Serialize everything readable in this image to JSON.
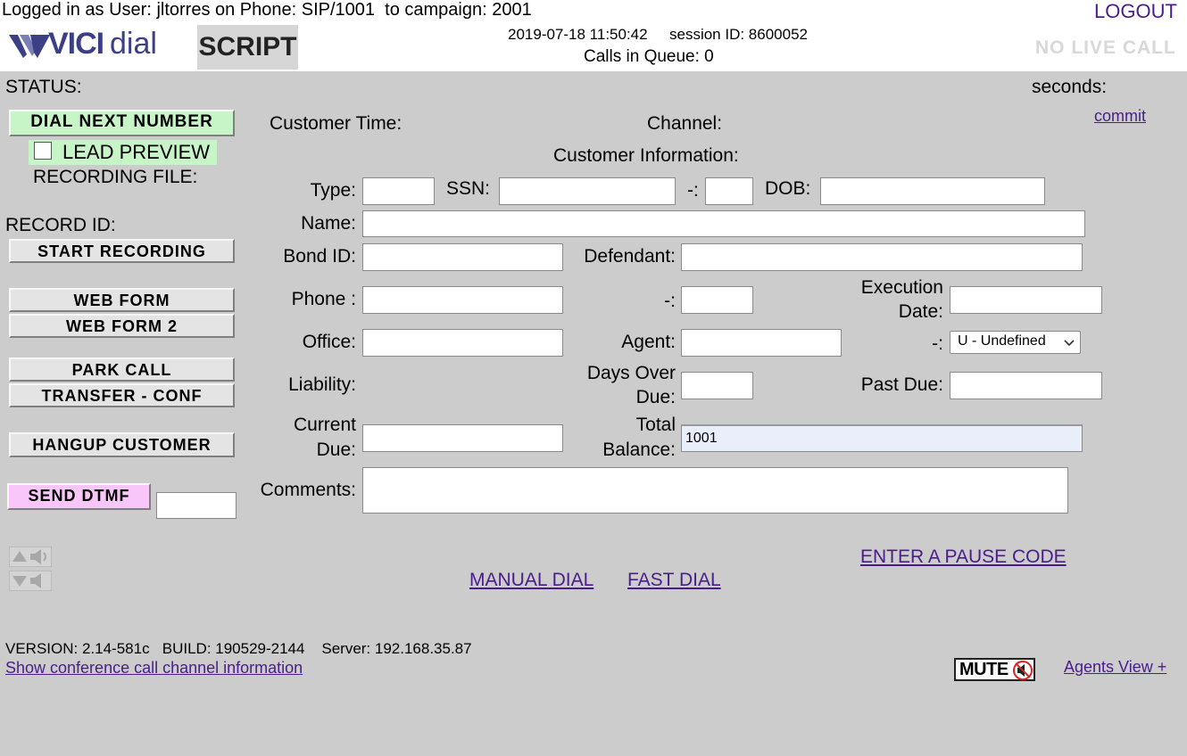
{
  "header": {
    "login_info": "Logged in as User: jltorres on Phone: SIP/1001  to campaign: 2001",
    "logout": "LOGOUT",
    "logo_vici": "VICI",
    "logo_dial": "dial",
    "script_tab": "SCRIPT",
    "datetime": "2019-07-18 11:50:42",
    "session": "session ID: 8600052",
    "queue": "Calls in Queue: 0",
    "live_call": "NO LIVE CALL"
  },
  "left": {
    "status": "STATUS:",
    "dial_next": "DIAL NEXT NUMBER",
    "lead_preview": "LEAD PREVIEW",
    "recording_file": "RECORDING FILE:",
    "record_id": "RECORD ID:",
    "start_recording": "START RECORDING",
    "web_form": "WEB FORM",
    "web_form2": "WEB FORM 2",
    "park_call": "PARK CALL",
    "transfer_conf": "TRANSFER - CONF",
    "hangup": "HANGUP CUSTOMER",
    "send_dtmf": "SEND DTMF"
  },
  "info": {
    "seconds": "seconds:",
    "commit": "commit",
    "customer_time": "Customer Time:",
    "channel": "Channel:",
    "customer_information": "Customer Information:"
  },
  "form": {
    "type": "Type:",
    "ssn": "SSN:",
    "dash": "-:",
    "dob": "DOB:",
    "name": "Name:",
    "bond_id": "Bond ID:",
    "defendant": "Defendant:",
    "phone": "Phone :",
    "execution_1": "Execution",
    "execution_2": "Date:",
    "office": "Office:",
    "agent": "Agent:",
    "gender_value": "U - Undefined",
    "liability": "Liability:",
    "days_over_1": "Days Over",
    "days_over_2": "Due:",
    "past_due": "Past Due:",
    "current_due_1": "Current",
    "current_due_2": "Due:",
    "total_balance_1": "Total",
    "total_balance_2": "Balance:",
    "total_balance_value": "1001",
    "comments": "Comments:"
  },
  "links": {
    "pause_code": "ENTER A PAUSE CODE",
    "manual_dial": "MANUAL DIAL",
    "fast_dial": "FAST DIAL",
    "conference": "Show conference call channel information",
    "agents_view": "Agents View +"
  },
  "footer": {
    "version": "VERSION: 2.14-581c   BUILD: 190529-2144    Server: 192.168.35.87",
    "mute": "MUTE"
  },
  "colors": {
    "background": "#cccccc",
    "dial_next_bg": "#c8f5c8",
    "send_dtmf_bg": "#f8c6f8",
    "link": "#4a1c8c",
    "balance_bg": "#e8eefa"
  }
}
